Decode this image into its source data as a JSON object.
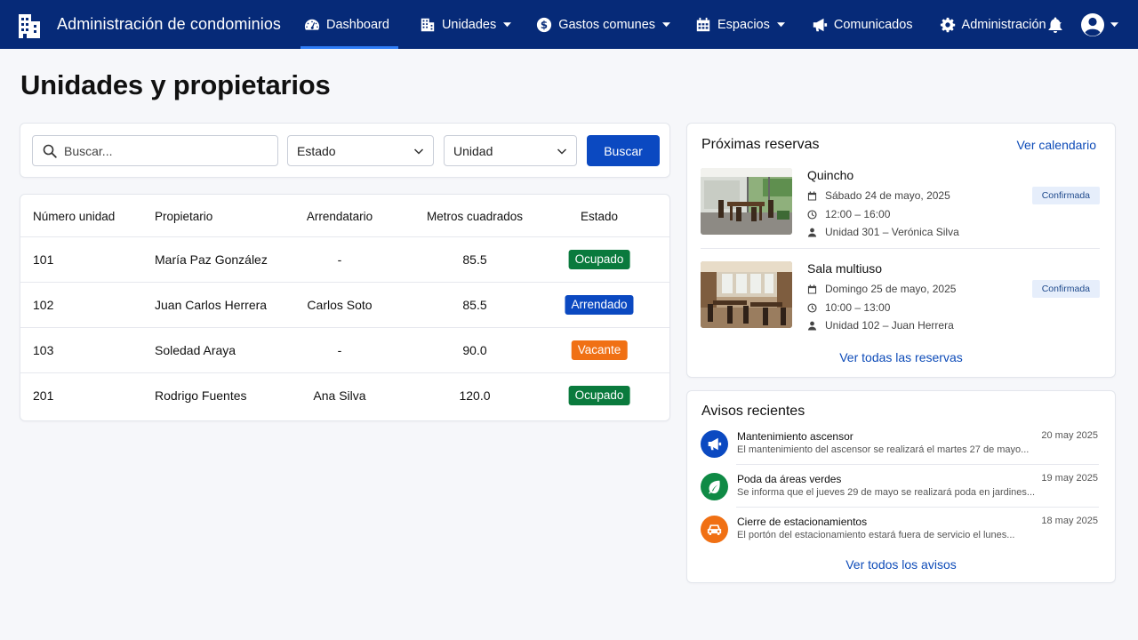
{
  "nav": {
    "title": "Administración de condominios",
    "items": [
      {
        "label": "Dashboard",
        "icon": "dashboard-gauge-icon",
        "active": true,
        "dropdown": false
      },
      {
        "label": "Unidades",
        "icon": "building-icon",
        "dropdown": true
      },
      {
        "label": "Gastos comunes",
        "icon": "dollar-coin-icon",
        "dropdown": true
      },
      {
        "label": "Espacios",
        "icon": "calendar-icon",
        "dropdown": true
      },
      {
        "label": "Comunicados",
        "icon": "megaphone-icon",
        "dropdown": false
      },
      {
        "label": "Administración",
        "icon": "gear-icon",
        "dropdown": true
      }
    ],
    "colors": {
      "background": "#062a78",
      "active_indicator": "#2f7df6"
    }
  },
  "page": {
    "title": "Unidades y propietarios"
  },
  "filters": {
    "search_placeholder": "Buscar...",
    "estado_label": "Estado",
    "unidad_label": "Unidad",
    "search_button": "Buscar"
  },
  "table": {
    "columns": [
      "Número unidad",
      "Propietario",
      "Arrendatario",
      "Metros cuadrados",
      "Estado"
    ],
    "rows": [
      {
        "unidad": "101",
        "propietario": "María Paz González",
        "arrendatario": "-",
        "metros": "85.5",
        "estado": "Ocupado",
        "estado_color": "#0a7a3d"
      },
      {
        "unidad": "102",
        "propietario": "Juan Carlos Herrera",
        "arrendatario": "Carlos Soto",
        "metros": "85.5",
        "estado": "Arrendado",
        "estado_color": "#0b49c1"
      },
      {
        "unidad": "103",
        "propietario": "Soledad Araya",
        "arrendatario": "-",
        "metros": "90.0",
        "estado": "Vacante",
        "estado_color": "#f07014"
      },
      {
        "unidad": "201",
        "propietario": "Rodrigo Fuentes",
        "arrendatario": "Ana Silva",
        "metros": "120.0",
        "estado": "Ocupado",
        "estado_color": "#0a7a3d"
      }
    ]
  },
  "reservas": {
    "title": "Próximas reservas",
    "calendar_link": "Ver calendario",
    "items": [
      {
        "name": "Quincho",
        "date": "Sábado 24 de mayo, 2025",
        "time": "12:00 – 16:00",
        "unit": "Unidad 301 – Verónica Silva",
        "status": "Confirmada"
      },
      {
        "name": "Sala multiuso",
        "date": "Domingo 25 de mayo, 2025",
        "time": "10:00 – 13:00",
        "unit": "Unidad 102 – Juan Herrera",
        "status": "Confirmada"
      }
    ],
    "all_link": "Ver todas las reservas"
  },
  "avisos": {
    "title": "Avisos recientes",
    "items": [
      {
        "title": "Mantenimiento ascensor",
        "text": "El mantenimiento del ascensor se realizará el martes 27 de mayo...",
        "date": "20 may 2025",
        "icon": "megaphone-icon",
        "color": "#0b49c1"
      },
      {
        "title": "Poda da áreas verdes",
        "text": "Se informa que el jueves 29 de mayo se realizará poda en jardines...",
        "date": "19 may 2025",
        "icon": "leaf-icon",
        "color": "#0f8a45"
      },
      {
        "title": "Cierre de estacionamientos",
        "text": "El portón del estacionamiento estará fuera de servicio el lunes...",
        "date": "18 may 2025",
        "icon": "car-icon",
        "color": "#f07014"
      }
    ],
    "all_link": "Ver todos los avisos"
  }
}
